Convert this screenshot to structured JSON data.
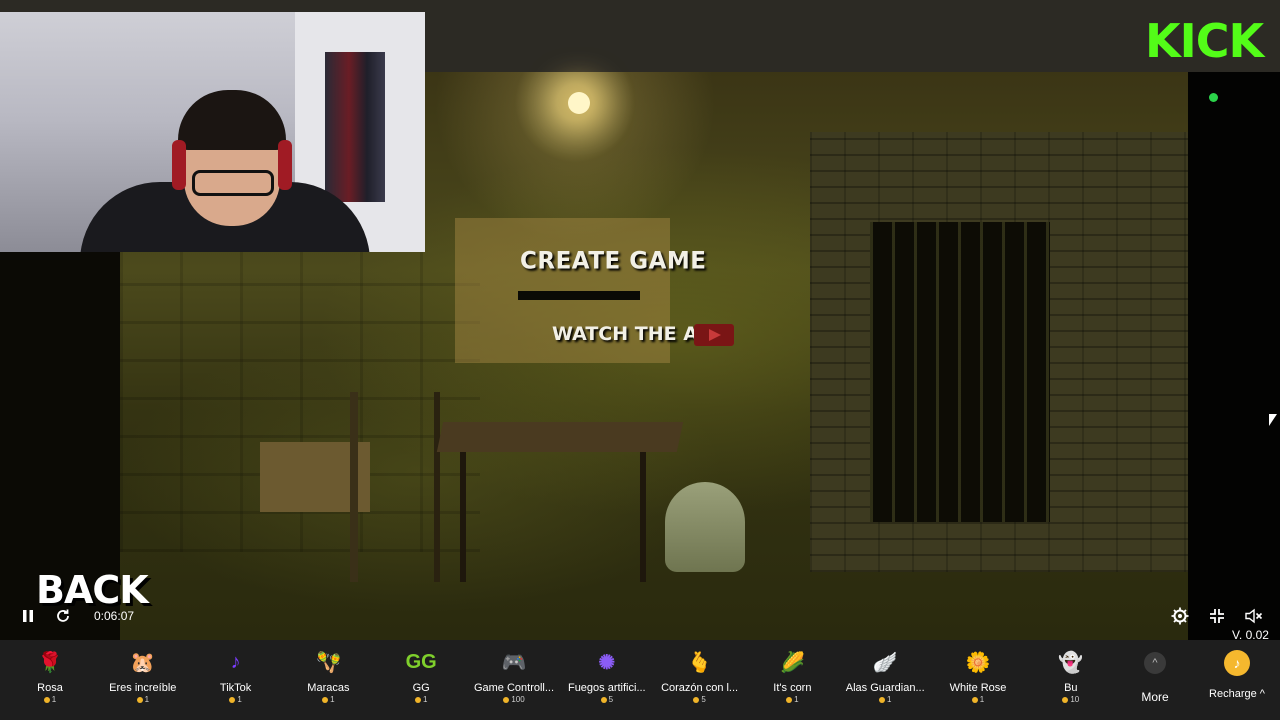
{
  "brand": {
    "logo_text": "KICK",
    "accent": "#53fc18"
  },
  "game": {
    "menu": {
      "create_game": "CREATE GAME",
      "watch_ad": "WATCH THE AD"
    },
    "back_label": "BACK"
  },
  "player": {
    "elapsed": "0:06:07",
    "version": "V. 0.02",
    "state": "playing"
  },
  "gifts": [
    {
      "name": "Rosa",
      "price": "1",
      "icon": "rose-icon",
      "glyph": "🌹"
    },
    {
      "name": "Eres increíble",
      "price": "1",
      "icon": "hamster-icon",
      "glyph": "🐹"
    },
    {
      "name": "TikTok",
      "price": "1",
      "icon": "tiktok-icon",
      "glyph": "♪"
    },
    {
      "name": "Maracas",
      "price": "1",
      "icon": "maracas-icon",
      "glyph": "🪇"
    },
    {
      "name": "GG",
      "price": "1",
      "icon": "gg-icon",
      "glyph": "GG"
    },
    {
      "name": "Game Controll...",
      "price": "100",
      "icon": "game-controller-icon",
      "glyph": "🎮"
    },
    {
      "name": "Fuegos artifici...",
      "price": "5",
      "icon": "fireworks-icon",
      "glyph": "✺"
    },
    {
      "name": "Corazón con l...",
      "price": "5",
      "icon": "finger-heart-icon",
      "glyph": "🫰"
    },
    {
      "name": "It's corn",
      "price": "1",
      "icon": "corn-icon",
      "glyph": "🌽"
    },
    {
      "name": "Alas Guardian...",
      "price": "1",
      "icon": "wings-icon",
      "glyph": "🪽"
    },
    {
      "name": "White Rose",
      "price": "1",
      "icon": "white-rose-icon",
      "glyph": "🌼"
    },
    {
      "name": "Bu",
      "price": "10",
      "icon": "ghost-icon",
      "glyph": "👻"
    }
  ],
  "more": {
    "label": "More",
    "glyph": "^"
  },
  "recharge": {
    "label": "Recharge ^",
    "glyph": "♪"
  }
}
